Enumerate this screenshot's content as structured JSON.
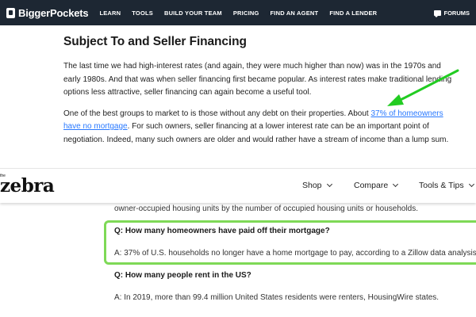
{
  "nav": {
    "logo_text": "BiggerPockets",
    "links": [
      "LEARN",
      "TOOLS",
      "BUILD YOUR TEAM",
      "PRICING",
      "FIND AN AGENT",
      "FIND A LENDER"
    ],
    "forums_label": "FORUMS"
  },
  "article": {
    "title": "Subject To and Seller Financing",
    "p1": "The last time we had high-interest rates (and again, they were much higher than now) was in the 1970s and early 1980s. And that was when seller financing first became popular. As interest rates make traditional lending options less attractive, seller financing can again become a useful tool.",
    "p2_before": "One of the best groups to market to is those without any debt on their properties. About ",
    "p2_link": "37% of homeowners have no mortgage",
    "p2_after": ". For such owners, seller financing at a lower interest rate can be an important point of negotiation. Indeed, many such owners are older and would rather have a stream of income than a lump sum."
  },
  "zebra": {
    "logo_the": "the",
    "logo": "zebra",
    "menu": [
      "Shop",
      "Compare",
      "Tools & Tips"
    ]
  },
  "faq": {
    "intro": "owner-occupied housing units by the number of occupied housing units or households.",
    "q1": "Q: How many homeowners have paid off their mortgage?",
    "a1": "A: 37% of U.S. households no longer have a home mortgage to pay, according to a Zillow data analysis",
    "q2": "Q: How many people rent in the US?",
    "a2": "A: In 2019, more than 99.4 million United States residents were renters, HousingWire states."
  },
  "colors": {
    "nav_bg": "#1d2733",
    "link": "#2979ff",
    "annotation_green": "#22cc22",
    "highlight_green": "#7ed957"
  }
}
